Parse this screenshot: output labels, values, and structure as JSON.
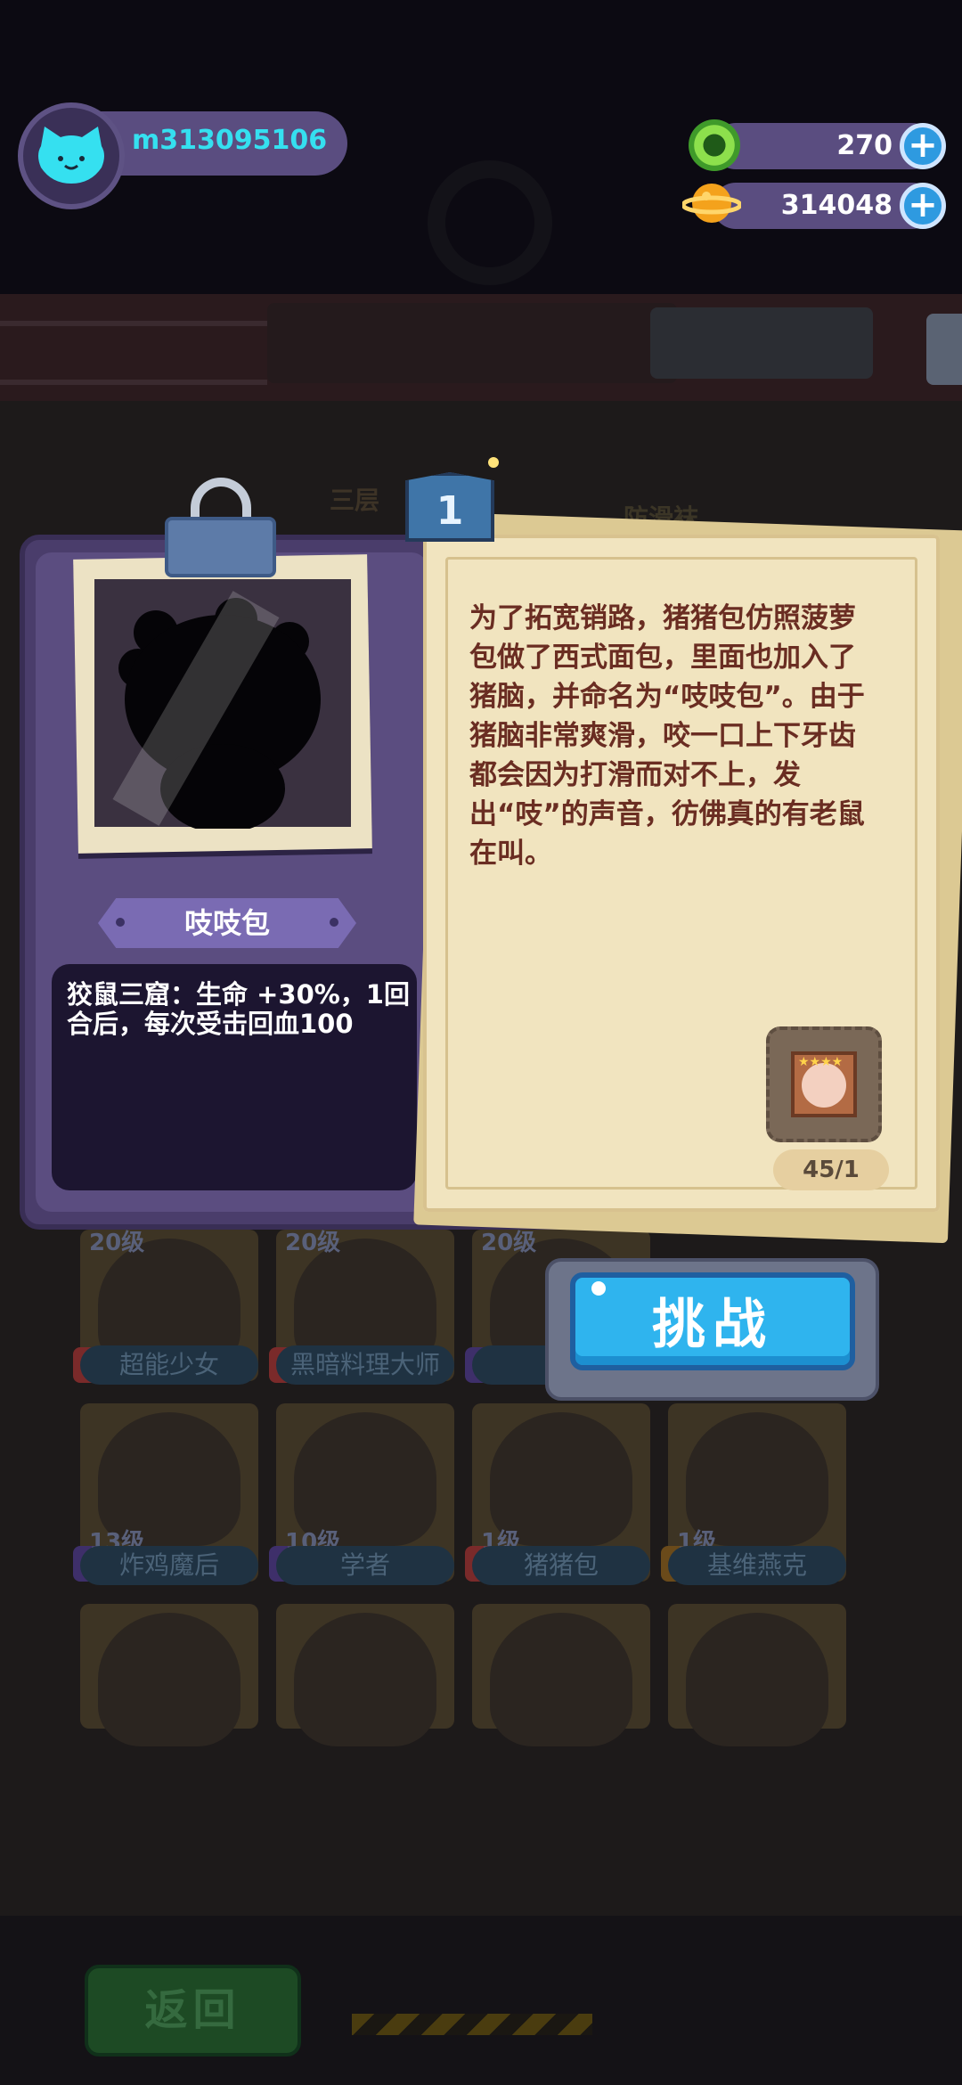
{
  "player": {
    "username": "m313095106"
  },
  "resources": {
    "gems": {
      "value": "270",
      "icon": "green-gem-icon"
    },
    "coins": {
      "value": "314048",
      "icon": "planet-coin-icon"
    }
  },
  "background": {
    "sign_left": "三层",
    "sign_right": "防滑袜",
    "characters_row1": [
      {
        "level": "20级",
        "name": "超能少女"
      },
      {
        "level": "20级",
        "name": "黑暗料理大师"
      },
      {
        "level": "20级",
        "name": ""
      }
    ],
    "characters_row2": [
      {
        "level": "13级",
        "name": "炸鸡魔后"
      },
      {
        "level": "10级",
        "name": "学者"
      },
      {
        "level": "1级",
        "name": "猪猪包"
      },
      {
        "level": "1级",
        "name": "基维燕克"
      }
    ],
    "back_button": "返回"
  },
  "modal": {
    "tab_number": "1",
    "character_name": "吱吱包",
    "skill_text": "狡鼠三窟：生命 +30%，1回合后，每次受击回血100",
    "story_text": "为了拓宽销路，猪猪包仿照菠萝包做了西式面包，里面也加入了猪脑，并命名为“吱吱包”。由于猪脑非常爽滑，咬一口上下牙齿都会因为打滑而对不上，发出“吱”的声音，彷佛真的有老鼠在叫。",
    "fragment_count": "45/1",
    "challenge_button": "挑战"
  },
  "colors": {
    "accent": "#2fb4ee",
    "panel": "#4a3d6b",
    "paper": "#f1e4bf",
    "story_text": "#6a2d22",
    "username": "#35e0f0"
  }
}
